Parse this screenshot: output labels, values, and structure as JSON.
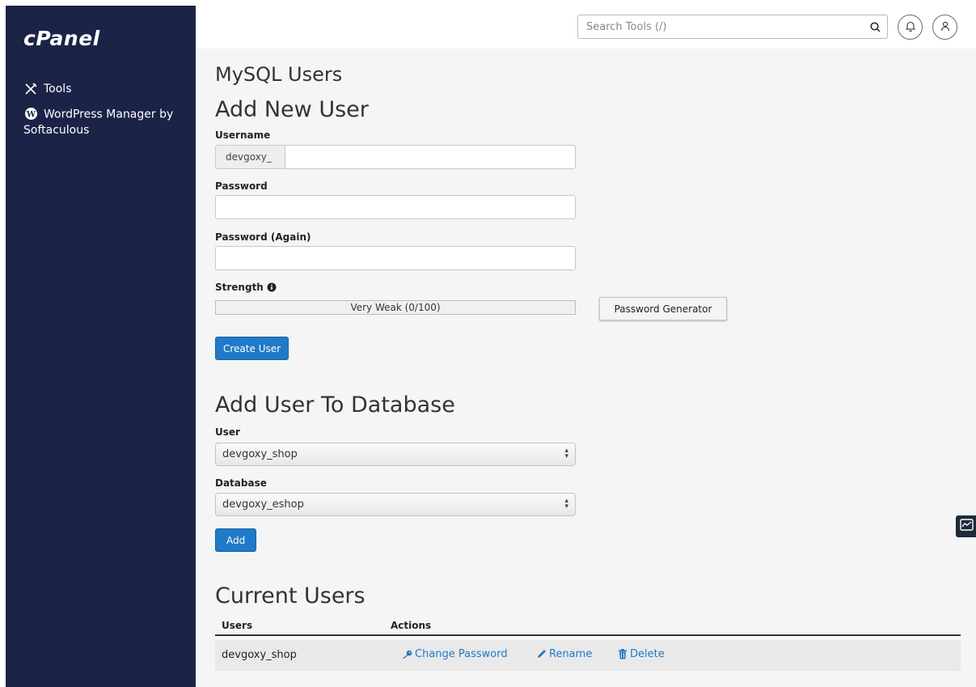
{
  "brand": {
    "logo_text": "cPanel"
  },
  "sidebar": {
    "items": [
      {
        "label": "Tools",
        "icon": "tools-icon"
      },
      {
        "label": "WordPress Manager by Softaculous",
        "icon": "wordpress-icon"
      }
    ]
  },
  "header": {
    "search_placeholder": "Search Tools (/)"
  },
  "page": {
    "title": "MySQL Users"
  },
  "add_user": {
    "heading": "Add New User",
    "username_label": "Username",
    "username_prefix": "devgoxy_",
    "username_value": "",
    "password_label": "Password",
    "password_again_label": "Password (Again)",
    "strength_label": "Strength",
    "strength_text": "Very Weak (0/100)",
    "strength_value": 0,
    "password_generator_label": "Password Generator",
    "create_button_label": "Create User"
  },
  "add_to_db": {
    "heading": "Add User To Database",
    "user_label": "User",
    "user_selected": "devgoxy_shop",
    "database_label": "Database",
    "database_selected": "devgoxy_eshop",
    "add_button_label": "Add"
  },
  "current_users": {
    "heading": "Current Users",
    "columns": [
      "Users",
      "Actions"
    ],
    "rows": [
      {
        "user": "devgoxy_shop",
        "actions": [
          "Change Password",
          "Rename",
          "Delete"
        ]
      }
    ]
  },
  "colors": {
    "sidebar_bg": "#1b2347",
    "primary": "#1f7ac9",
    "link": "#1f7ac9"
  }
}
